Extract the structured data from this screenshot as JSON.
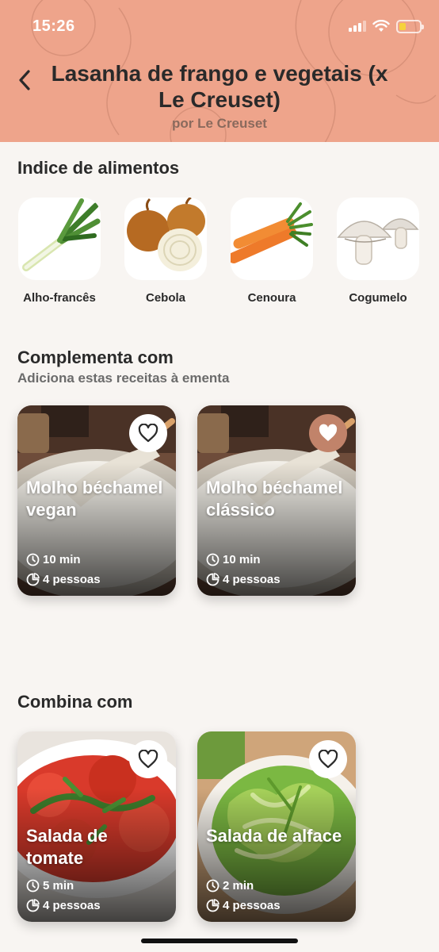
{
  "status_bar": {
    "time": "15:26"
  },
  "header": {
    "title": "Lasanha de frango e vegetais (x Le Creuset)",
    "subtitle": "por Le Creuset",
    "back_icon": "chevron-left-icon"
  },
  "food_index": {
    "title": "Indice de alimentos",
    "items": [
      {
        "label": "Alho-francês"
      },
      {
        "label": "Cebola"
      },
      {
        "label": "Cenoura"
      },
      {
        "label": "Cogumelo"
      }
    ]
  },
  "complement": {
    "title": "Complementa com",
    "subtitle": "Adiciona estas receitas à ementa",
    "cards": [
      {
        "title": "Molho béchamel vegan",
        "time": "10 min",
        "servings": "4 pessoas",
        "favorited": false
      },
      {
        "title": "Molho béchamel clássico",
        "time": "10 min",
        "servings": "4 pessoas",
        "favorited": true
      }
    ]
  },
  "combine": {
    "title": "Combina com",
    "cards": [
      {
        "title": "Salada de tomate",
        "time": "5 min",
        "servings": "4 pessoas",
        "favorited": false
      },
      {
        "title": "Salada de alface",
        "time": "2 min",
        "servings": "4 pessoas",
        "favorited": false
      }
    ]
  },
  "colors": {
    "header_bg": "#eea48b",
    "page_bg": "#f8f5f2",
    "favorite_active": "#c1836a"
  }
}
